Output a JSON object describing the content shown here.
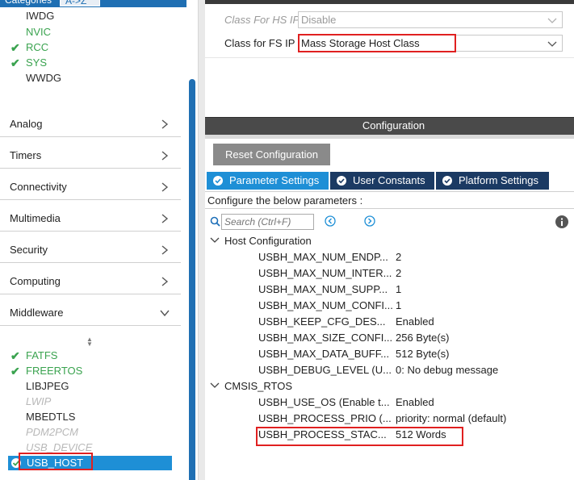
{
  "left_panel": {
    "tabs": [
      "Categories",
      "A->Z"
    ],
    "tree_items_top": [
      {
        "label": "IWDG",
        "checked": false,
        "style": "dark"
      },
      {
        "label": "NVIC",
        "checked": false,
        "style": "green"
      },
      {
        "label": "RCC",
        "checked": true,
        "style": "green"
      },
      {
        "label": "SYS",
        "checked": true,
        "style": "green"
      },
      {
        "label": "WWDG",
        "checked": false,
        "style": "dark"
      }
    ],
    "categories": [
      "Analog",
      "Timers",
      "Connectivity",
      "Multimedia",
      "Security",
      "Computing",
      "Middleware"
    ],
    "middleware_items": [
      {
        "label": "FATFS",
        "checked": true,
        "style": "green"
      },
      {
        "label": "FREERTOS",
        "checked": true,
        "style": "green"
      },
      {
        "label": "LIBJPEG",
        "checked": false,
        "style": "dark"
      },
      {
        "label": "LWIP",
        "checked": false,
        "style": "disabled"
      },
      {
        "label": "MBEDTLS",
        "checked": false,
        "style": "dark"
      },
      {
        "label": "PDM2PCM",
        "checked": false,
        "style": "disabled"
      },
      {
        "label": "USB_DEVICE",
        "checked": false,
        "style": "disabled"
      }
    ],
    "selected_item": "USB_HOST"
  },
  "ip_settings": {
    "hs": {
      "label": "Class For HS IP",
      "value": "Disable"
    },
    "fs": {
      "label": "Class for FS IP",
      "value": "Mass Storage Host Class"
    }
  },
  "configuration": {
    "title": "Configuration",
    "reset_label": "Reset Configuration",
    "tabs": [
      "Parameter Settings",
      "User Constants",
      "Platform Settings"
    ],
    "caption": "Configure the below parameters :",
    "search_placeholder": "Search (Ctrl+F)",
    "groups": [
      {
        "name": "Host Configuration",
        "params": [
          {
            "name": "USBH_MAX_NUM_ENDP...",
            "value": "2"
          },
          {
            "name": "USBH_MAX_NUM_INTER...",
            "value": "2"
          },
          {
            "name": "USBH_MAX_NUM_SUPP...",
            "value": "1"
          },
          {
            "name": "USBH_MAX_NUM_CONFI...",
            "value": "1"
          },
          {
            "name": "USBH_KEEP_CFG_DES...",
            "value": "Enabled"
          },
          {
            "name": "USBH_MAX_SIZE_CONFI...",
            "value": "256 Byte(s)"
          },
          {
            "name": "USBH_MAX_DATA_BUFF...",
            "value": "512 Byte(s)"
          },
          {
            "name": "USBH_DEBUG_LEVEL (U...",
            "value": "0: No debug message"
          }
        ]
      },
      {
        "name": "CMSIS_RTOS",
        "params": [
          {
            "name": "USBH_USE_OS (Enable t...",
            "value": "Enabled"
          },
          {
            "name": "USBH_PROCESS_PRIO (...",
            "value": "priority: normal (default)"
          },
          {
            "name": "USBH_PROCESS_STAC...",
            "value": "512 Words"
          }
        ]
      }
    ]
  },
  "colors": {
    "accent": "#1e8fd6",
    "dark_tab": "#1b3a63",
    "enabled_green": "#3aa34f",
    "highlight_red": "#e02020"
  }
}
